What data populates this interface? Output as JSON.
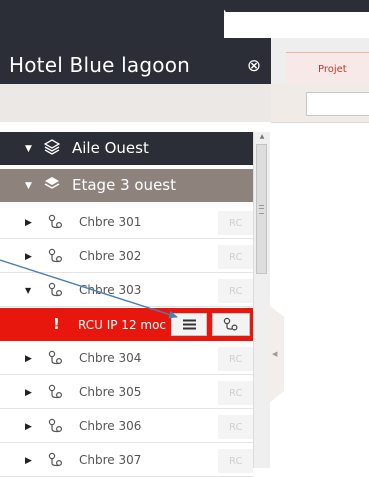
{
  "header": {
    "title": "Hotel Blue lagoon"
  },
  "tabs": [
    {
      "label": "Projet"
    }
  ],
  "search": {
    "value": ""
  },
  "tree": {
    "aile": {
      "label": "Aile Ouest"
    },
    "etage": {
      "label": "Etage 3 ouest"
    },
    "rooms": [
      {
        "label": "Chbre 301",
        "badge": "RC"
      },
      {
        "label": "Chbre 302",
        "badge": "RC"
      },
      {
        "label": "Chbre 303",
        "badge": "RC"
      }
    ],
    "alert": {
      "icon": "!",
      "label": "RCU IP 12 moc"
    },
    "rooms_after": [
      {
        "label": "Chbre 304",
        "badge": "RC"
      },
      {
        "label": "Chbre 305",
        "badge": "RC"
      },
      {
        "label": "Chbre 306",
        "badge": "RC"
      },
      {
        "label": "Chbre 307",
        "badge": "RC"
      }
    ]
  },
  "colors": {
    "dark": "#2b2e37",
    "floor_row": "#8d837c",
    "alert": "#e8170e",
    "accent": "#c0392b",
    "annotation_arrow": "#4a7fb0"
  },
  "icons": {
    "close": "close-circle-icon",
    "aile": "building-layers-icon",
    "etage": "floor-layer-icon",
    "room": "room-link-icon",
    "alert": "exclamation-icon",
    "menu": "hamburger-menu-icon",
    "link": "link-nodes-icon",
    "collapse": "chevron-left-icon"
  }
}
